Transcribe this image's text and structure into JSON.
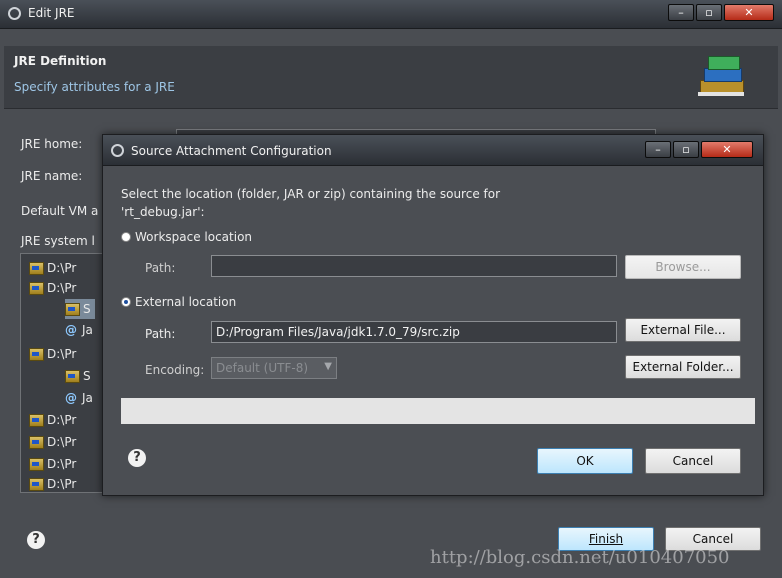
{
  "main_window": {
    "title": "Edit JRE",
    "header_title": "JRE Definition",
    "header_subtitle": "Specify attributes for a JRE",
    "labels": {
      "jre_home": "JRE home:",
      "jre_name": "JRE name:",
      "default_vm": "Default VM a",
      "system_libs": "JRE system l"
    },
    "tree_items": [
      "D:\\Pr",
      "D:\\Pr",
      "S",
      "Ja",
      "D:\\Pr",
      "S",
      "Ja",
      "D:\\Pr",
      "D:\\Pr",
      "D:\\Pr",
      "D:\\Pr"
    ],
    "help_icon": "?",
    "finish_label": "Finish",
    "cancel_label": "Cancel"
  },
  "dialog": {
    "title": "Source Attachment Configuration",
    "description_line1": "Select the location (folder, JAR or zip) containing the source for",
    "description_line2": "'rt_debug.jar':",
    "workspace_option": "Workspace location",
    "path_label_1": "Path:",
    "path_value_1": "",
    "browse_label": "Browse...",
    "external_option": "External location",
    "path_label_2": "Path:",
    "path_value_2": "D:/Program Files/Java/jdk1.7.0_79/src.zip",
    "external_file_label": "External File...",
    "encoding_label": "Encoding:",
    "encoding_value": "Default (UTF-8)",
    "external_folder_label": "External Folder...",
    "help_icon": "?",
    "ok_label": "OK",
    "cancel_label": "Cancel"
  },
  "watermark": "http://blog.csdn.net/u010407050"
}
